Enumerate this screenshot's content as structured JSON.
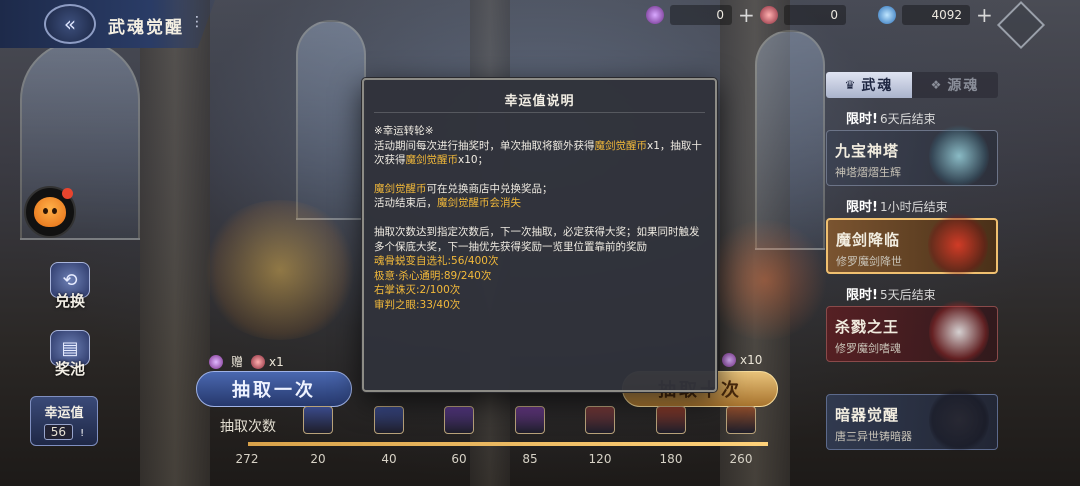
{
  "header": {
    "title": "武魂觉醒",
    "menu_glyph": "⋮"
  },
  "currencies": [
    {
      "name": "purple-gem-a",
      "value": "0",
      "plus": "+"
    },
    {
      "name": "purple-gem-b",
      "value": "0",
      "plus": ""
    },
    {
      "name": "blue-crystal",
      "value": "4092",
      "plus": "+"
    }
  ],
  "left_menu": {
    "exchange_label": "兑换",
    "pool_label": "奖池",
    "luck_label": "幸运值",
    "luck_value": "56",
    "luck_info": "!"
  },
  "right_panel": {
    "tab_active": "武魂",
    "tab_inactive": "源魂",
    "limit_prefix": "限时!",
    "items": [
      {
        "limit": "6天后结束",
        "title": "九宝神塔",
        "subtitle": "神塔熠熠生辉"
      },
      {
        "limit": "1小时后结束",
        "title": "魔剑降临",
        "subtitle": "修罗魔剑降世"
      },
      {
        "limit": "5天后结束",
        "title": "杀戮之王",
        "subtitle": "修罗魔剑嗜魂"
      },
      {
        "limit": "",
        "title": "暗器觉醒",
        "subtitle": "唐三异世铸暗器"
      }
    ]
  },
  "draw": {
    "single_label": "抽取一次",
    "ten_label": "抽取十次",
    "single_gift_prefix": "赠",
    "single_gift_qty": "x1",
    "ten_cost_qty": "x10"
  },
  "progress": {
    "label": "抽取次数",
    "current": "272",
    "current_value": 272,
    "milestones": [
      "20",
      "40",
      "60",
      "85",
      "120",
      "180",
      "260"
    ]
  },
  "modal": {
    "title": "幸运值说明",
    "heading": "※幸运转轮※",
    "p1_a": "活动期间每次进行抽奖时，单次抽取将额外获得",
    "p1_hl1": "魔剑觉醒币",
    "p1_b": "x1，抽取十次获得",
    "p1_hl2": "魔剑觉醒币",
    "p1_c": "x10；",
    "p2_hl1": "魔剑觉醒币",
    "p2_a": "可在兑换商店中兑换奖品；",
    "p2_b": "活动结束后，",
    "p2_hl2": "魔剑觉醒币会消失",
    "p3": "抽取次数达到指定次数后，下一次抽取，必定获得大奖；如果同时触发多个保底大奖，下一抽优先获得奖励一览里位置靠前的奖励",
    "rewards": [
      "魂骨蜕变自选礼:56/400次",
      "极意·杀心通明:89/240次",
      "右掌诛灭:2/100次",
      "审判之眼:33/40次"
    ]
  },
  "colors": {
    "highlight": "#f2b93a",
    "modal_bg": "#30323a",
    "accent_blue": "#2a3c66"
  }
}
